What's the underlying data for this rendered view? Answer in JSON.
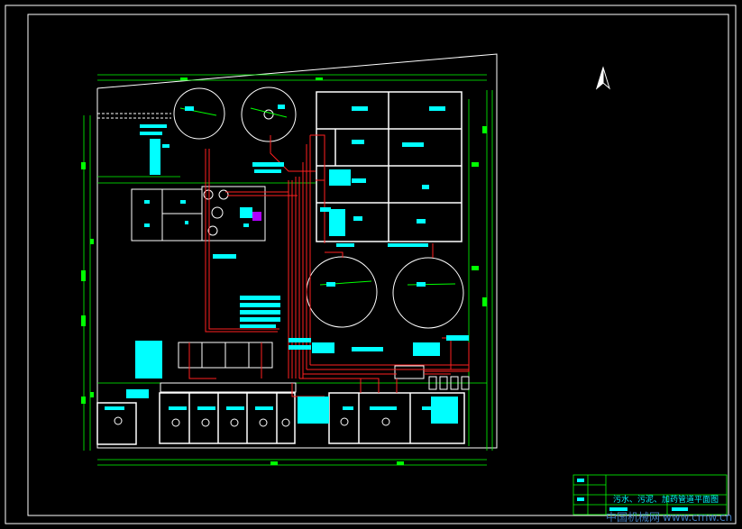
{
  "drawing": {
    "title_block": {
      "title": "污水、污泥、加药管道平面图",
      "watermark": "中国机械网",
      "watermark_url": "www.cmw.cn"
    },
    "colors": {
      "background": "#000000",
      "frame": "#ffffff",
      "dimension": "#00ff00",
      "pipe": "#ff2020",
      "label": "#00ffff",
      "structure": "#ffffff",
      "watermark": "#4a8fd9"
    },
    "north_arrow": "north-arrow-icon"
  }
}
